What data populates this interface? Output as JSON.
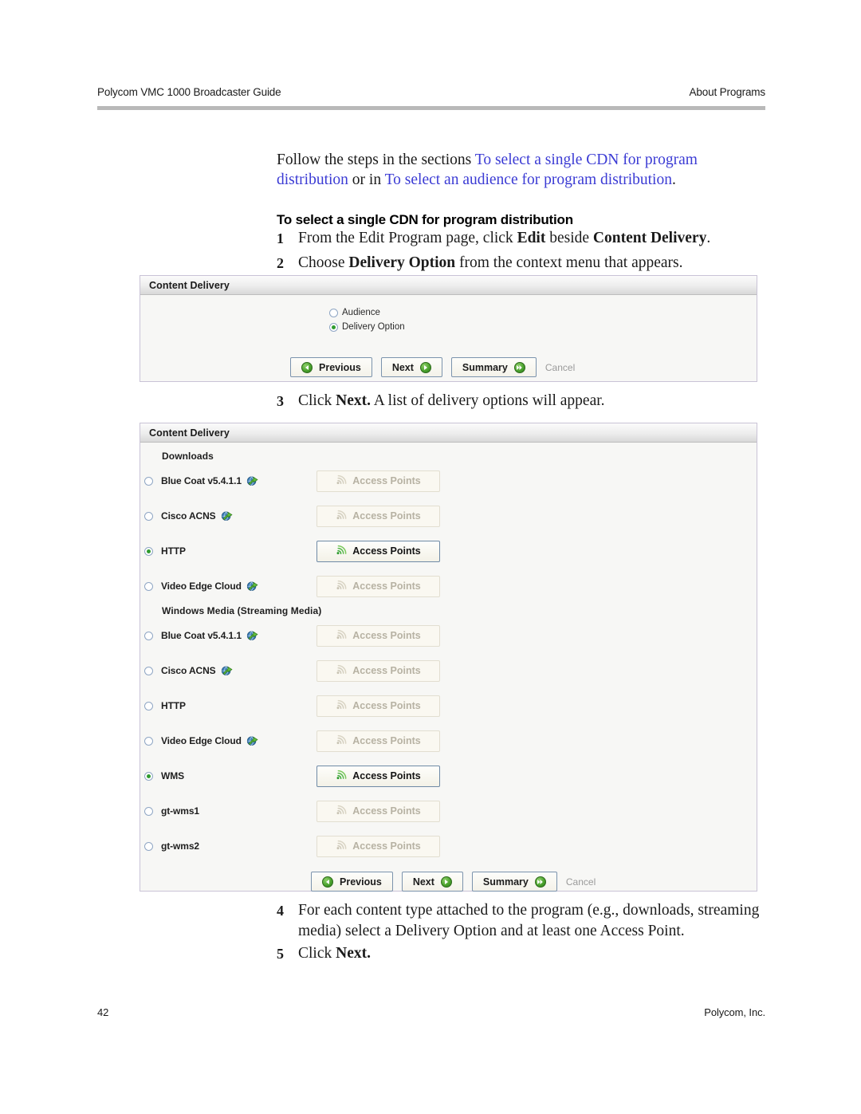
{
  "header": {
    "left": "Polycom VMC 1000 Broadcaster Guide",
    "right": "About Programs"
  },
  "intro": {
    "lead": "Follow the steps in the sections ",
    "link1": "To select a single CDN for program distribution",
    "middle": " or in ",
    "link2": "To select an audience for program distribution",
    "end": "."
  },
  "section_heading": "To select a single CDN for program distribution",
  "steps": {
    "s1": {
      "num": "1",
      "a": "From the Edit Program page, click ",
      "b1": "Edit",
      "b": " beside ",
      "b2": "Content Delivery",
      "c": "."
    },
    "s2": {
      "num": "2",
      "a": "Choose ",
      "b1": "Delivery Option",
      "b": " from the context menu that appears.",
      "b2": "",
      "c": ""
    },
    "s3": {
      "num": "3",
      "a": "Click ",
      "b1": "Next.",
      "b": " A list of delivery options will appear.",
      "b2": "",
      "c": ""
    },
    "s4": {
      "num": "4",
      "a": "For each content type attached to the program (e.g., downloads, streaming media) select a Delivery Option and at least one Access Point.",
      "b1": "",
      "b": "",
      "b2": "",
      "c": ""
    },
    "s5": {
      "num": "5",
      "a": "Click ",
      "b1": "Next.",
      "b": "",
      "b2": "",
      "c": ""
    }
  },
  "panel_small": {
    "title": "Content Delivery",
    "options": [
      {
        "label": "Audience",
        "selected": false
      },
      {
        "label": "Delivery Option",
        "selected": true
      }
    ],
    "buttons": {
      "previous": "Previous",
      "next": "Next",
      "summary": "Summary",
      "cancel": "Cancel"
    }
  },
  "panel_large": {
    "title": "Content Delivery",
    "groups": [
      {
        "label": "Downloads",
        "rows": [
          {
            "name": "Blue Coat v5.4.1.1",
            "icon": "globe-icon",
            "selected": false,
            "button": "Access Points",
            "button_enabled": false
          },
          {
            "name": "Cisco ACNS",
            "icon": "globe-icon",
            "selected": false,
            "button": "Access Points",
            "button_enabled": false
          },
          {
            "name": "HTTP",
            "icon": "",
            "selected": true,
            "button": "Access Points",
            "button_enabled": true
          },
          {
            "name": "Video Edge Cloud",
            "icon": "globe-icon",
            "selected": false,
            "button": "Access Points",
            "button_enabled": false
          }
        ]
      },
      {
        "label": "Windows Media (Streaming Media)",
        "rows": [
          {
            "name": "Blue Coat v5.4.1.1",
            "icon": "globe-icon",
            "selected": false,
            "button": "Access Points",
            "button_enabled": false
          },
          {
            "name": "Cisco ACNS",
            "icon": "globe-icon",
            "selected": false,
            "button": "Access Points",
            "button_enabled": false
          },
          {
            "name": "HTTP",
            "icon": "",
            "selected": false,
            "button": "Access Points",
            "button_enabled": false
          },
          {
            "name": "Video Edge Cloud",
            "icon": "globe-icon",
            "selected": false,
            "button": "Access Points",
            "button_enabled": false
          },
          {
            "name": "WMS",
            "icon": "",
            "selected": true,
            "button": "Access Points",
            "button_enabled": true
          },
          {
            "name": "gt-wms1",
            "icon": "",
            "selected": false,
            "button": "Access Points",
            "button_enabled": false
          },
          {
            "name": "gt-wms2",
            "icon": "",
            "selected": false,
            "button": "Access Points",
            "button_enabled": false
          }
        ]
      }
    ],
    "buttons": {
      "previous": "Previous",
      "next": "Next",
      "summary": "Summary",
      "cancel": "Cancel"
    }
  },
  "footer": {
    "page_number": "42",
    "company": "Polycom, Inc."
  },
  "colors": {
    "link": "#3b3bd4",
    "accent_green": "#4ca32e",
    "panel_border": "#c9c3d6"
  }
}
